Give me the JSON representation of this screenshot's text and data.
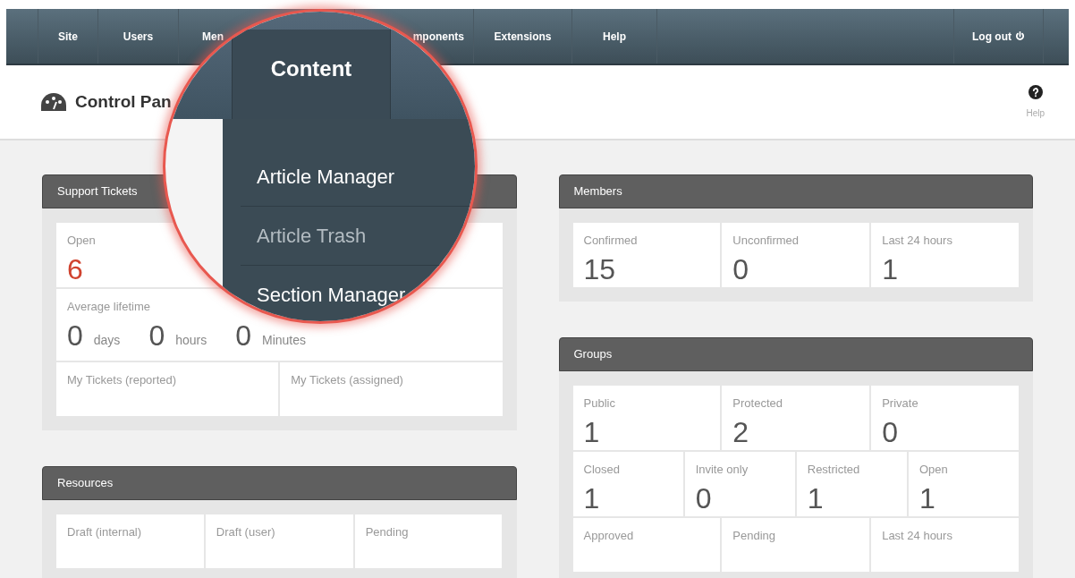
{
  "nav": {
    "items": [
      {
        "label": "Site"
      },
      {
        "label": "Users"
      },
      {
        "label": "Men"
      },
      {
        "label": "mponents"
      },
      {
        "label": "Extensions"
      },
      {
        "label": "Help"
      }
    ],
    "logout": "Log out"
  },
  "header": {
    "title": "Control Pan",
    "help": "Help"
  },
  "magnifier": {
    "tab": "Content",
    "menu": [
      {
        "label": "Article Manager",
        "highlighted": true
      },
      {
        "label": "Article Trash",
        "highlighted": false
      },
      {
        "label": "Section Manager",
        "highlighted": true
      }
    ]
  },
  "left_panels": [
    {
      "title": "Support Tickets",
      "rows": [
        [
          {
            "kind": "stat",
            "label": "Open",
            "value": "6",
            "color": "#d0432f"
          },
          {
            "kind": "stat"
          }
        ],
        [
          {
            "kind": "duration",
            "label": "Average lifetime",
            "parts": [
              {
                "value": "0",
                "unit": "days"
              },
              {
                "value": "0",
                "unit": "hours"
              },
              {
                "value": "0",
                "unit": "Minutes"
              }
            ]
          }
        ],
        [
          {
            "kind": "stat",
            "label": "My Tickets (reported)"
          },
          {
            "kind": "stat",
            "label": "My Tickets (assigned)"
          }
        ]
      ]
    },
    {
      "title": "Resources",
      "rows": [
        [
          {
            "kind": "stat",
            "label": "Draft (internal)"
          },
          {
            "kind": "stat",
            "label": "Draft (user)"
          },
          {
            "kind": "stat",
            "label": "Pending"
          }
        ]
      ]
    }
  ],
  "right_panels": [
    {
      "title": "Members",
      "rows": [
        [
          {
            "kind": "stat",
            "label": "Confirmed",
            "value": "15"
          },
          {
            "kind": "stat",
            "label": "Unconfirmed",
            "value": "0"
          },
          {
            "kind": "stat",
            "label": "Last 24 hours",
            "value": "1"
          }
        ]
      ]
    },
    {
      "title": "Groups",
      "rows": [
        [
          {
            "kind": "stat",
            "label": "Public",
            "value": "1"
          },
          {
            "kind": "stat",
            "label": "Protected",
            "value": "2"
          },
          {
            "kind": "stat",
            "label": "Private",
            "value": "0"
          }
        ],
        [
          {
            "kind": "stat",
            "label": "Closed",
            "value": "1"
          },
          {
            "kind": "stat",
            "label": "Invite only",
            "value": "0"
          },
          {
            "kind": "stat",
            "label": "Restricted",
            "value": "1"
          },
          {
            "kind": "stat",
            "label": "Open",
            "value": "1"
          }
        ],
        [
          {
            "kind": "stat",
            "label": "Approved"
          },
          {
            "kind": "stat",
            "label": "Pending"
          },
          {
            "kind": "stat",
            "label": "Last 24 hours"
          }
        ]
      ]
    }
  ]
}
